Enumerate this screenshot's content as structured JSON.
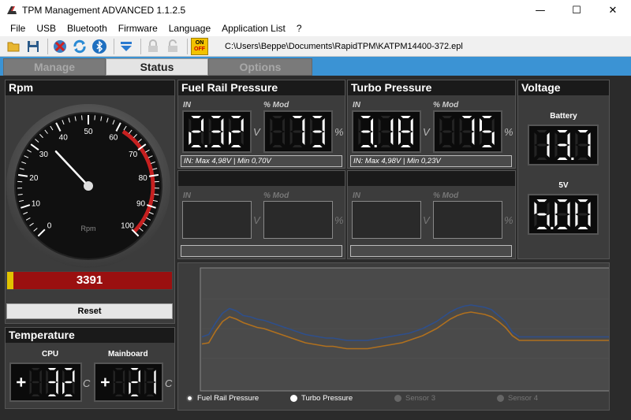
{
  "window": {
    "title": "TPM Management ADVANCED  1.1.2.5",
    "minimize": "—",
    "maximize": "☐",
    "close": "✕"
  },
  "menu": [
    "File",
    "USB",
    "Bluetooth",
    "Firmware",
    "Language",
    "Application List",
    "?"
  ],
  "toolbar": {
    "path": "C:\\Users\\Beppe\\Documents\\RapidTPM\\KATPM14400-372.epl",
    "onoff_top": "ON",
    "onoff_bottom": "OFF"
  },
  "tabs": [
    "Manage",
    "Status",
    "Options"
  ],
  "rpm": {
    "title": "Rpm",
    "gauge_label": "Rpm",
    "gauge_ticks": [
      "0",
      "10",
      "20",
      "30",
      "40",
      "50",
      "60",
      "70",
      "80",
      "90",
      "100"
    ],
    "value": "3391",
    "needle_value": 34,
    "reset_label": "Reset"
  },
  "temperature": {
    "title": "Temperature",
    "cpu_label": "CPU",
    "cpu_value": "+32",
    "mainboard_label": "Mainboard",
    "mainboard_value": "+21",
    "unit": "C"
  },
  "fuel": {
    "title": "Fuel Rail Pressure",
    "in_label": "IN",
    "mod_label": "% Mod",
    "in_value": "2.32",
    "mod_value": "73",
    "in_unit": "V",
    "mod_unit": "%",
    "info": "IN: Max 4,98V | Min 0,70V"
  },
  "turbo": {
    "title": "Turbo Pressure",
    "in_label": "IN",
    "mod_label": "% Mod",
    "in_value": "3.18",
    "mod_value": "75",
    "in_unit": "V",
    "mod_unit": "%",
    "info": "IN: Max 4,98V | Min 0,23V"
  },
  "sensor3": {
    "in_label": "IN",
    "mod_label": "% Mod",
    "in_unit": "V",
    "mod_unit": "%"
  },
  "sensor4": {
    "in_label": "IN",
    "mod_label": "% Mod",
    "in_unit": "V",
    "mod_unit": "%"
  },
  "voltage": {
    "title": "Voltage",
    "battery_label": "Battery",
    "battery_value": "13.7",
    "v5_label": "5V",
    "v5_value": "5.00"
  },
  "chart_legend": [
    "Fuel Rail Pressure",
    "Turbo Pressure",
    "Sensor 3",
    "Sensor 4"
  ],
  "colors": {
    "fuel_line": "#2e4f8c",
    "turbo_line": "#b0701e",
    "accent_tab": "#3b93d4",
    "rpm_bar": "#9a1010"
  },
  "chart_data": {
    "type": "line",
    "series": [
      {
        "name": "Fuel Rail Pressure",
        "values": [
          43,
          45,
          55,
          63,
          67,
          65,
          61,
          60,
          58,
          57,
          55,
          53,
          51,
          49,
          47,
          45,
          44,
          43,
          42,
          42,
          41,
          40,
          40,
          40,
          40,
          41,
          42,
          43,
          44,
          45,
          46,
          48,
          50,
          53,
          56,
          60,
          64,
          67,
          69,
          70,
          69,
          68,
          66,
          61,
          56,
          47,
          43,
          43,
          43,
          43,
          43,
          43,
          43,
          43,
          43,
          43,
          43,
          43,
          43,
          43
        ]
      },
      {
        "name": "Turbo Pressure",
        "values": [
          37,
          38,
          48,
          56,
          60,
          58,
          55,
          53,
          51,
          50,
          48,
          46,
          44,
          42,
          40,
          38,
          37,
          36,
          35,
          35,
          34,
          33,
          33,
          33,
          33,
          34,
          35,
          36,
          37,
          38,
          40,
          42,
          44,
          47,
          50,
          54,
          58,
          61,
          63,
          64,
          63,
          62,
          60,
          56,
          51,
          44,
          40,
          40,
          40,
          40,
          40,
          40,
          40,
          40,
          40,
          40,
          40,
          40,
          40,
          40
        ]
      }
    ]
  }
}
